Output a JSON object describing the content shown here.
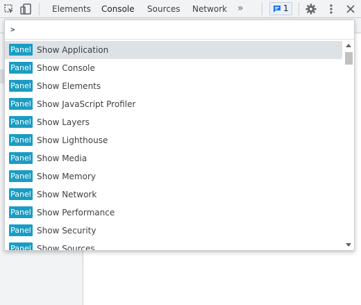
{
  "toolbar": {
    "tabs": [
      {
        "label": "Elements"
      },
      {
        "label": "Console"
      },
      {
        "label": "Sources"
      },
      {
        "label": "Network"
      }
    ],
    "more_tabs": "»",
    "issues_count": "1"
  },
  "palette": {
    "prompt": ">",
    "items": [
      {
        "badge": "Panel",
        "label": "Show Application"
      },
      {
        "badge": "Panel",
        "label": "Show Console"
      },
      {
        "badge": "Panel",
        "label": "Show Elements"
      },
      {
        "badge": "Panel",
        "label": "Show JavaScript Profiler"
      },
      {
        "badge": "Panel",
        "label": "Show Layers"
      },
      {
        "badge": "Panel",
        "label": "Show Lighthouse"
      },
      {
        "badge": "Panel",
        "label": "Show Media"
      },
      {
        "badge": "Panel",
        "label": "Show Memory"
      },
      {
        "badge": "Panel",
        "label": "Show Network"
      },
      {
        "badge": "Panel",
        "label": "Show Performance"
      },
      {
        "badge": "Panel",
        "label": "Show Security"
      },
      {
        "badge": "Panel",
        "label": "Show Sources"
      }
    ]
  },
  "colors": {
    "badge": "#1a9dc4",
    "selected_row": "#dee1e6",
    "toolbar": "#f1f3f4",
    "issues_accent": "#1a73e8"
  }
}
